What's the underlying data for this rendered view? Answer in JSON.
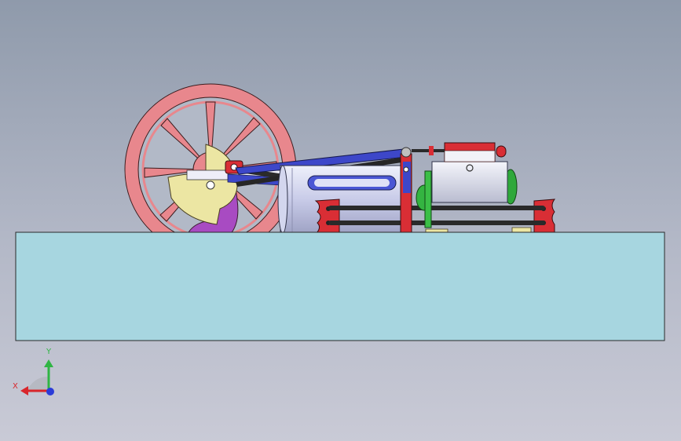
{
  "viewport": {
    "background_top": "#8f9aab",
    "background_bottom": "#c9cad6"
  },
  "model": {
    "base_color": "#a7d6e0",
    "flywheel_color": "#e88a90",
    "cylinder_color": "#c9ccec",
    "crank_color": "#e9e2a0",
    "connecting_rod_color": "#3d47c9",
    "frame_red": "#d92e35",
    "accent_green": "#2fa83b",
    "accent_purple": "#a848c0"
  },
  "triad": {
    "x_label": "X",
    "y_label": "Y",
    "x_color": "#d9262c",
    "y_color": "#2fb544",
    "z_color": "#2b3cd8"
  }
}
